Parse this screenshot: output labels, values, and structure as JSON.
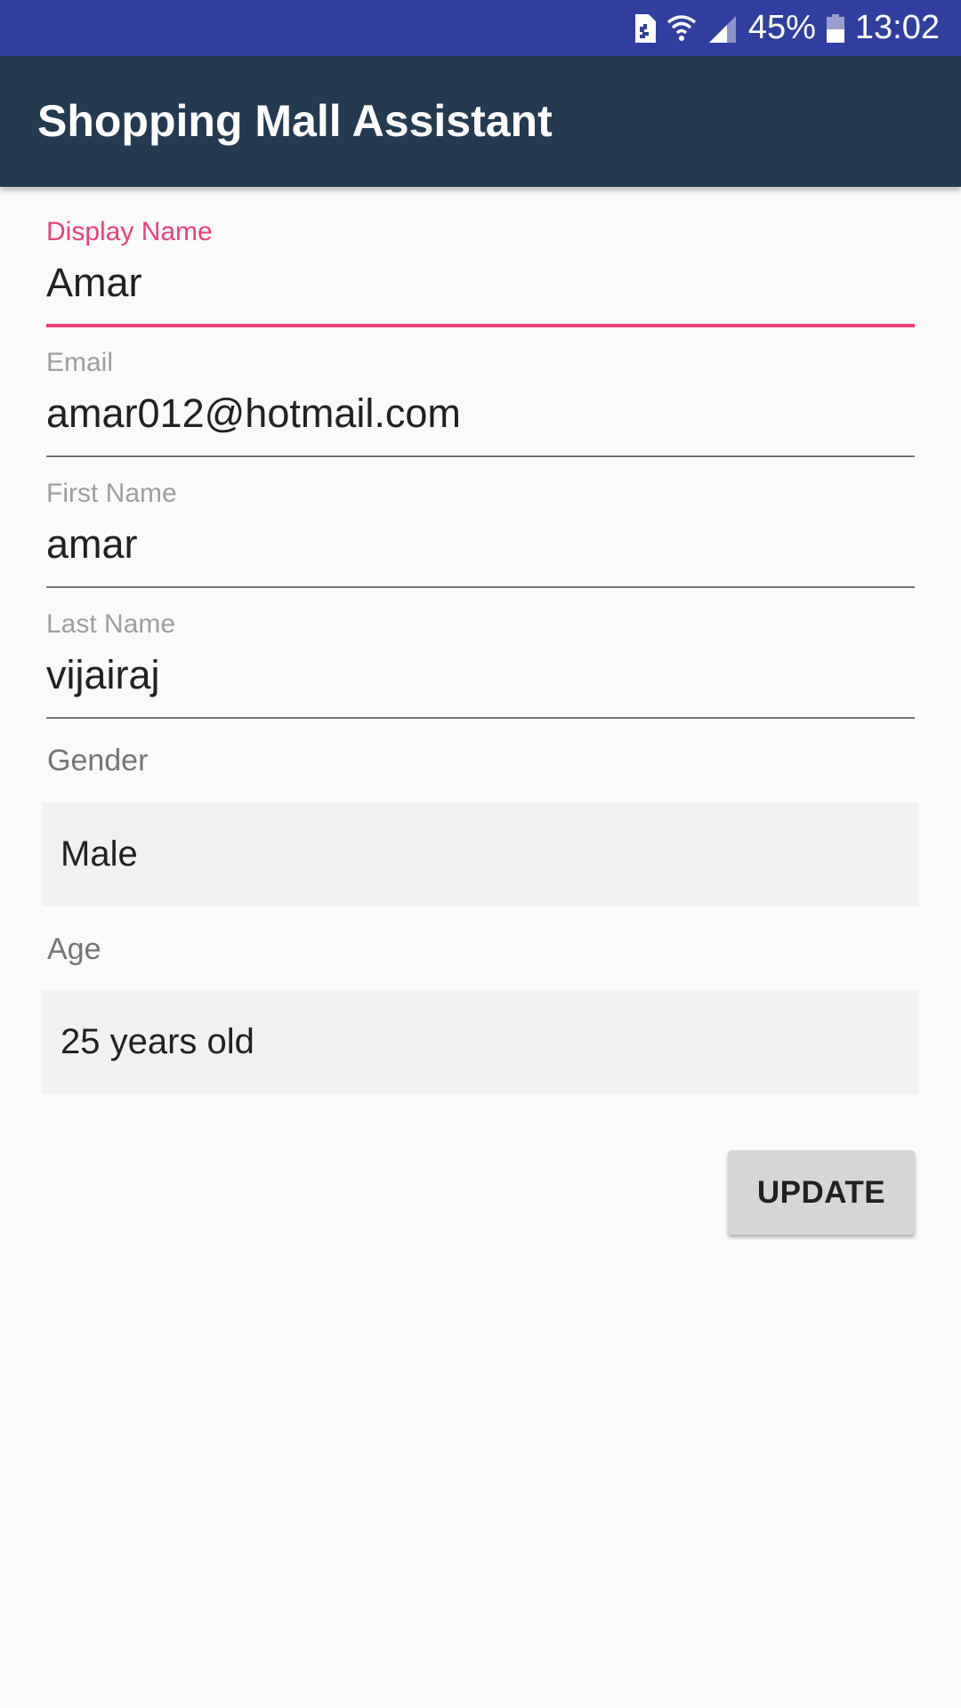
{
  "status_bar": {
    "battery_percent": "45%",
    "time": "13:02",
    "icons": [
      "sim-card-icon",
      "wifi-icon",
      "cell-signal-icon",
      "battery-icon"
    ]
  },
  "app_bar": {
    "title": "Shopping Mall Assistant"
  },
  "form": {
    "display_name": {
      "label": "Display Name",
      "value": "Amar"
    },
    "email": {
      "label": "Email",
      "value": "amar012@hotmail.com"
    },
    "first_name": {
      "label": "First Name",
      "value": "amar"
    },
    "last_name": {
      "label": "Last Name",
      "value": "vijairaj"
    },
    "gender": {
      "label": "Gender",
      "selected": "Male"
    },
    "age": {
      "label": "Age",
      "selected": "25 years old"
    },
    "update_label": "UPDATE"
  },
  "colors": {
    "status_bar": "#303f9f",
    "app_bar": "#243a51",
    "accent": "#ec407a",
    "background": "#fafafa",
    "select_background": "#f1f1f1",
    "button": "#d6d6d6"
  }
}
